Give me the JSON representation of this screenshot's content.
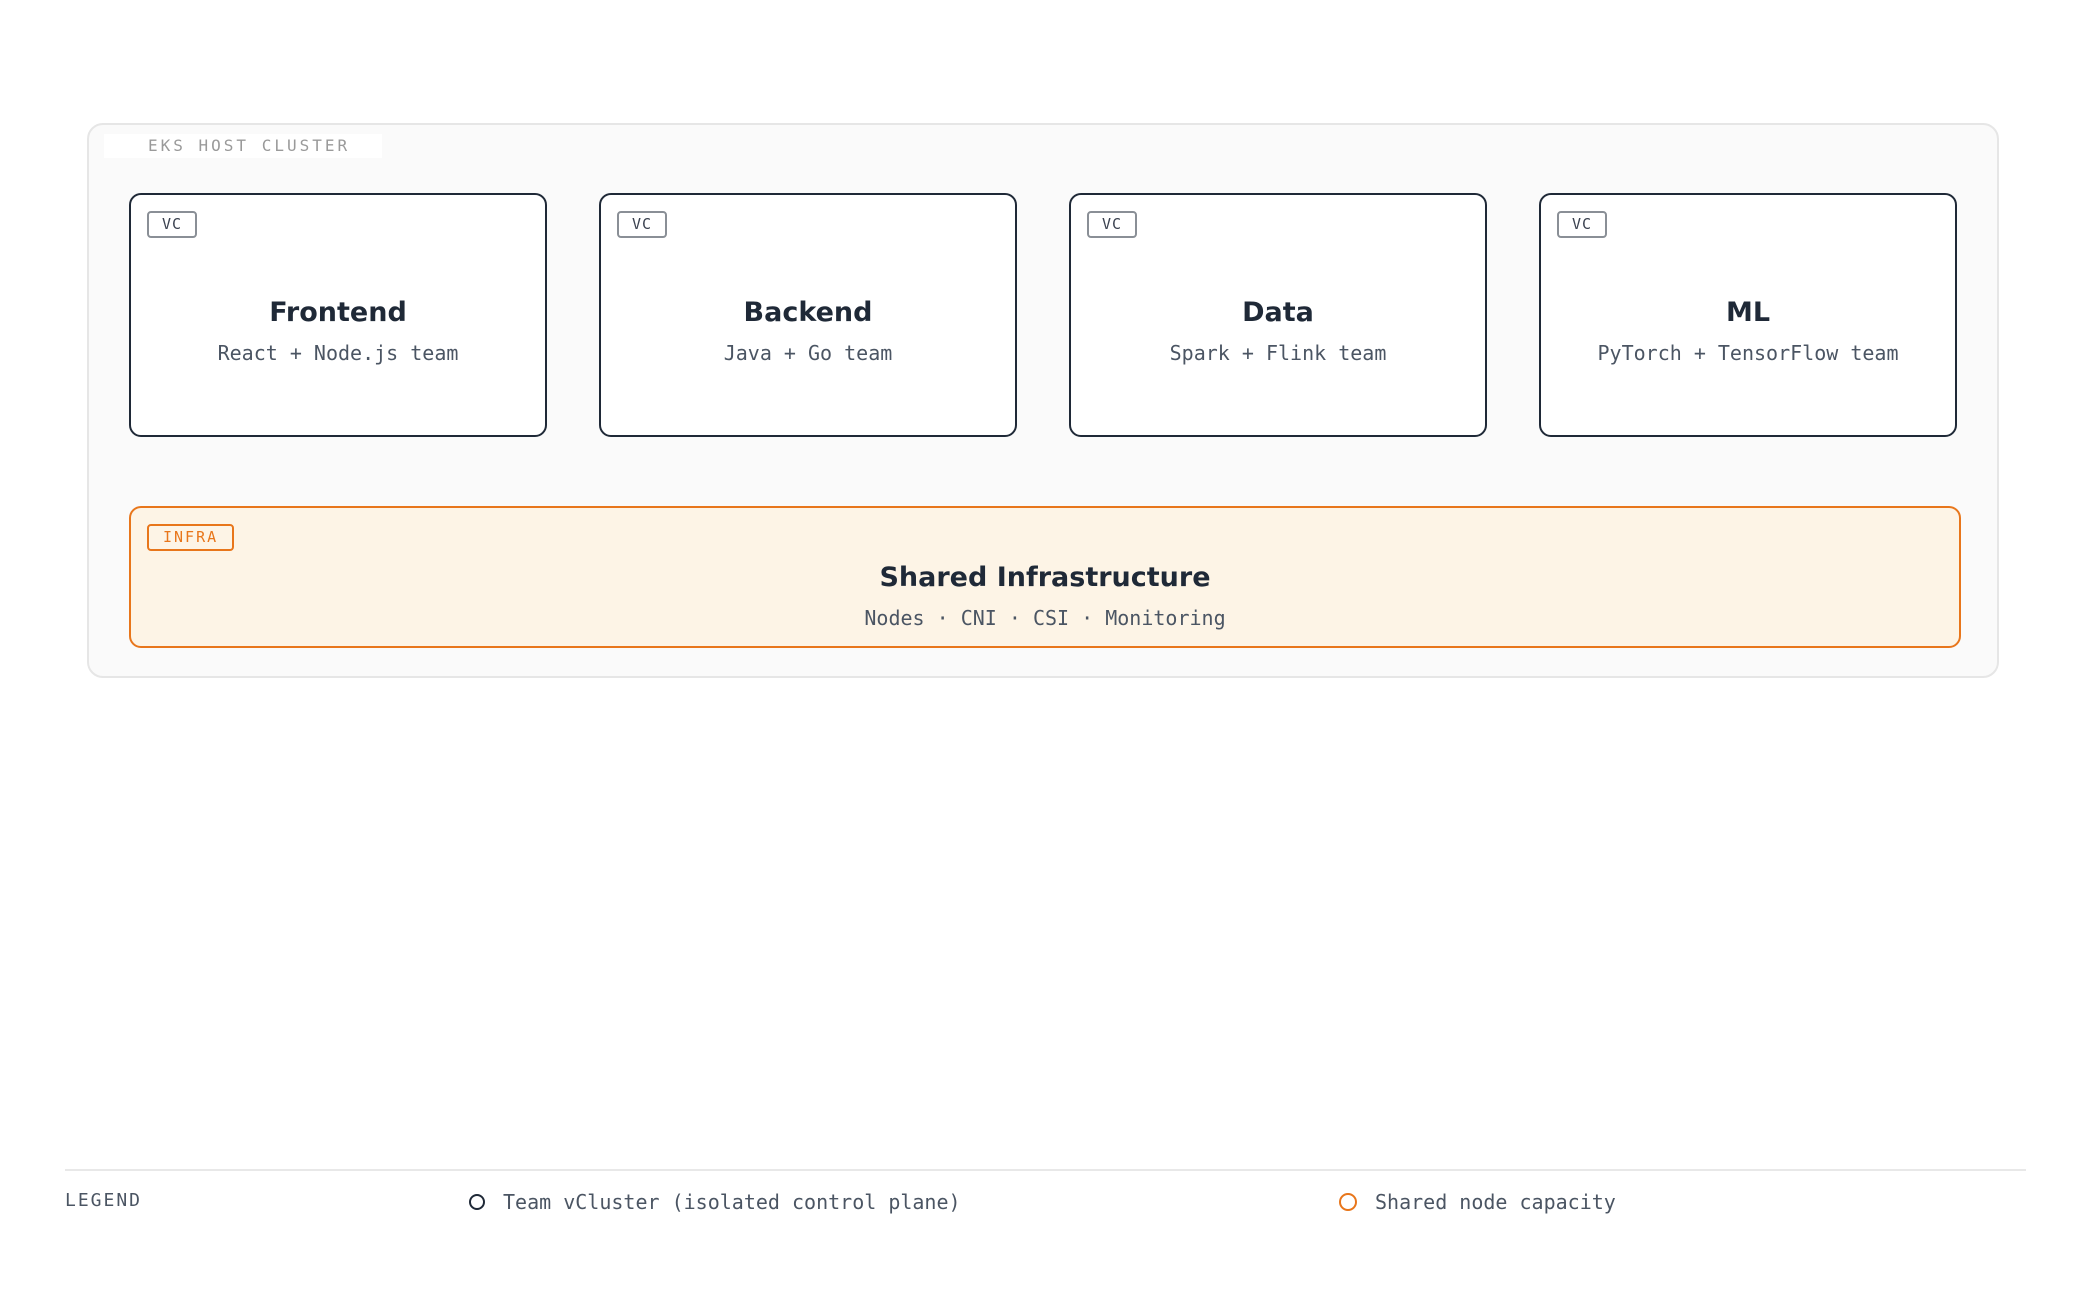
{
  "host": {
    "label": "EKS HOST CLUSTER"
  },
  "vclusters": [
    {
      "badge": "VC",
      "title": "Frontend",
      "subtitle": "React + Node.js team"
    },
    {
      "badge": "VC",
      "title": "Backend",
      "subtitle": "Java + Go team"
    },
    {
      "badge": "VC",
      "title": "Data",
      "subtitle": "Spark + Flink team"
    },
    {
      "badge": "VC",
      "title": "ML",
      "subtitle": "PyTorch + TensorFlow team"
    }
  ],
  "infra": {
    "badge": "INFRA",
    "title": "Shared Infrastructure",
    "subtitle": "Nodes · CNI · CSI · Monitoring"
  },
  "legend": {
    "label": "LEGEND",
    "items": [
      {
        "text": "Team vCluster (isolated control plane)",
        "color": "#1f2937"
      },
      {
        "text": "Shared node capacity",
        "color": "#e8761b"
      }
    ]
  },
  "colors": {
    "vcluster_border": "#1f2937",
    "infra_accent": "#e8761b",
    "infra_fill": "#fdf4e6",
    "host_fill": "#fafafa"
  }
}
